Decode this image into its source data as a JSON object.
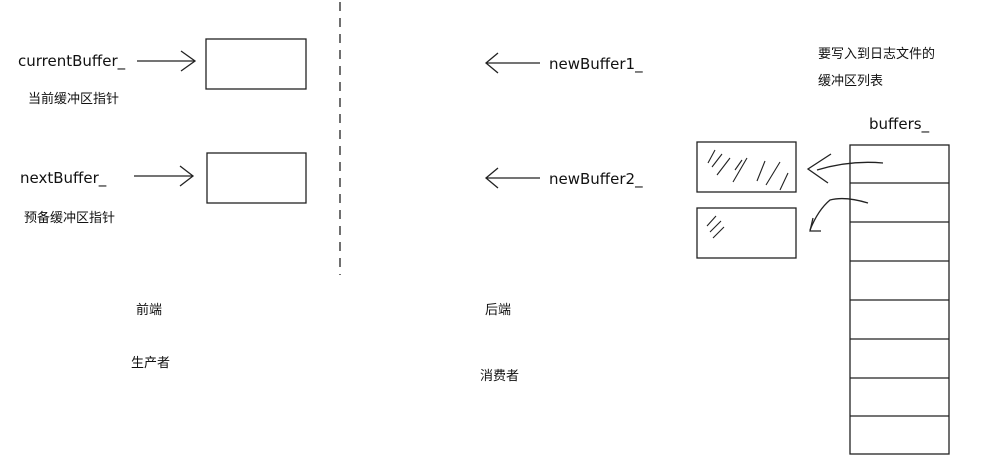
{
  "front": {
    "current_label": "currentBuffer_",
    "current_desc": "当前缓冲区指针",
    "next_label": "nextBuffer_",
    "next_desc": "预备缓冲区指针",
    "side_label": "前端",
    "role_label": "生产者"
  },
  "back": {
    "new1_label": "newBuffer1_",
    "new2_label": "newBuffer2_",
    "side_label": "后端",
    "role_label": "消费者",
    "list_note_line1": "要写入到日志文件的",
    "list_note_line2": "缓冲区列表",
    "list_label": "buffers_",
    "list_rows": 8
  }
}
